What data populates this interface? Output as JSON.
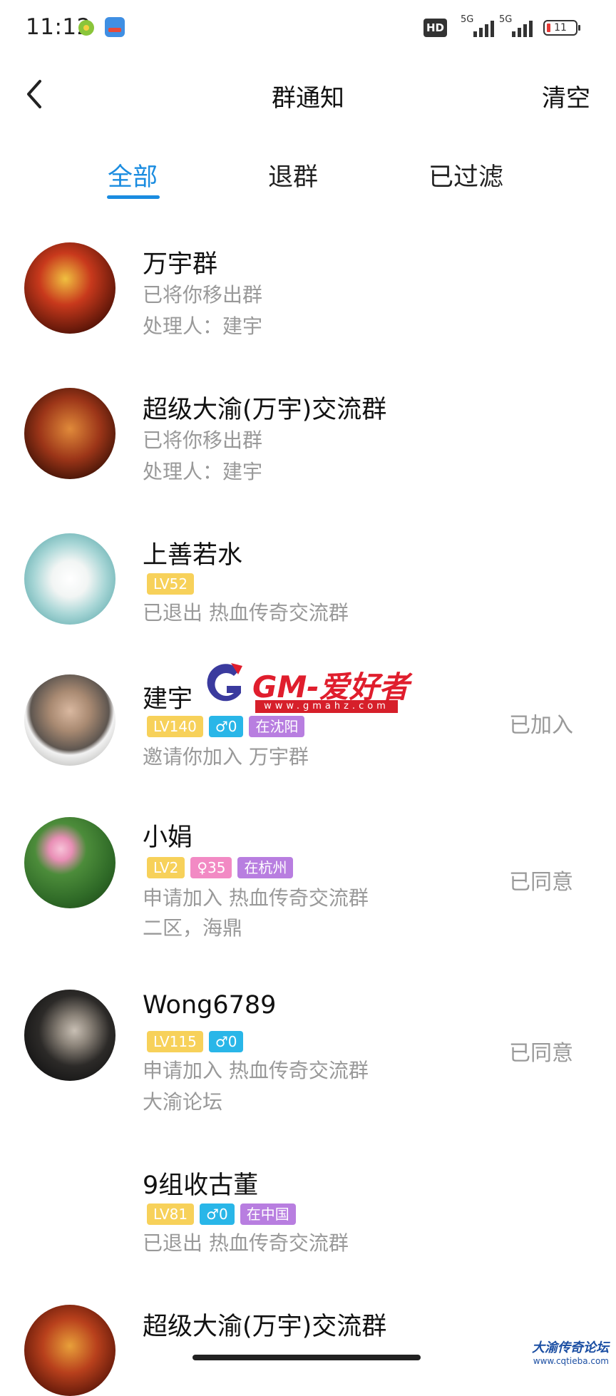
{
  "status_bar": {
    "time": "11:12",
    "hd": "HD",
    "network1": "5G",
    "network2": "5G",
    "battery": "11"
  },
  "header": {
    "title": "群通知",
    "clear_label": "清空"
  },
  "tabs": [
    {
      "label": "全部",
      "active": true
    },
    {
      "label": "退群",
      "active": false
    },
    {
      "label": "已过滤",
      "active": false
    }
  ],
  "notifications": [
    {
      "name": "万宇群",
      "line1": "已将你移出群",
      "line2": "处理人：建宇",
      "status": ""
    },
    {
      "name": "超级大渝(万宇)交流群",
      "line1": "已将你移出群",
      "line2": "处理人：建宇",
      "status": ""
    },
    {
      "name": "上善若水",
      "tags": [
        "LV52"
      ],
      "line1": "已退出 热血传奇交流群",
      "status": ""
    },
    {
      "name": "建宇",
      "tags": [
        "LV140",
        "♂0",
        "在沈阳"
      ],
      "line1": "邀请你加入 万宇群",
      "status": "已加入"
    },
    {
      "name": "小娟",
      "tags": [
        "LV2",
        "♀35",
        "在杭州"
      ],
      "line1": "申请加入 热血传奇交流群",
      "line2": "二区，海鼎",
      "status": "已同意"
    },
    {
      "name": "Wong6789",
      "tags": [
        "LV115",
        "♂0"
      ],
      "line1": "申请加入 热血传奇交流群",
      "line2": "大渝论坛",
      "status": "已同意"
    },
    {
      "name": "9组收古董",
      "tags": [
        "LV81",
        "♂0",
        "在中国"
      ],
      "line1": "已退出 热血传奇交流群",
      "status": ""
    },
    {
      "name": "超级大渝(万宇)交流群",
      "status": ""
    }
  ],
  "watermark": {
    "text": "GM-爱好者",
    "url": "www.gmahz.com"
  },
  "footer_logo": {
    "title": "大渝传奇论坛",
    "url": "www.cqtieba.com"
  },
  "colors": {
    "accent": "#1a8ce0",
    "lv_tag": "#f7d15a",
    "male_tag": "#29b6e8",
    "female_tag": "#f28ac4",
    "location_tag": "#b87ee0"
  }
}
